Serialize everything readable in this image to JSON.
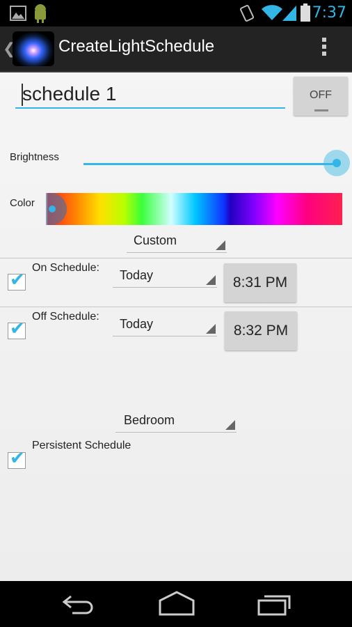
{
  "status_bar": {
    "time": "7:37",
    "icons": [
      "image-icon",
      "android-icon",
      "rotate-icon",
      "wifi-icon",
      "signal-icon",
      "battery-icon"
    ]
  },
  "action_bar": {
    "title": "CreateLightSchedule",
    "app_icon": "app-logo",
    "overflow_icon": "overflow-menu-icon"
  },
  "schedule": {
    "name_value": "schedule 1",
    "toggle_label": "OFF"
  },
  "brightness": {
    "label": "Brightness",
    "value_percent": 100
  },
  "color": {
    "label": "Color",
    "selector_position_percent": 0
  },
  "color_mode": {
    "selected": "Custom"
  },
  "on_schedule": {
    "label": "On Schedule:",
    "checked": true,
    "day": "Today",
    "time": "8:31 PM"
  },
  "off_schedule": {
    "label": "Off Schedule:",
    "checked": true,
    "day": "Today",
    "time": "8:32 PM"
  },
  "room": {
    "selected": "Bedroom"
  },
  "persistent": {
    "label": "Persistent Schedule",
    "checked": true
  },
  "nav_bar": {
    "icons": [
      "back-icon",
      "home-icon",
      "recent-apps-icon"
    ]
  },
  "colors": {
    "accent": "#33b5e5",
    "action_bar_bg": "#232323",
    "content_bg": "#f2f2f2",
    "button_bg": "#d4d4d4"
  }
}
